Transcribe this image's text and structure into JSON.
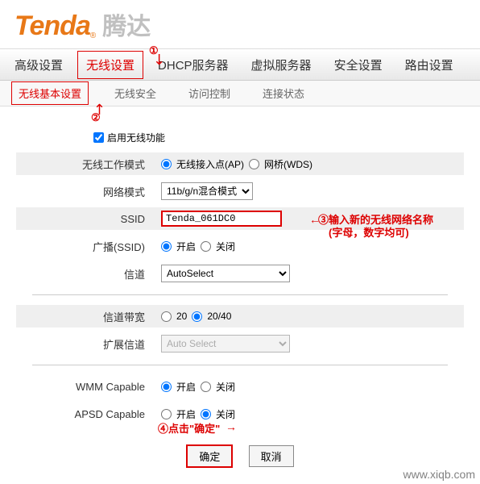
{
  "logo": {
    "en": "Tenda",
    "cn": "腾达"
  },
  "nav": {
    "items": [
      "高级设置",
      "无线设置",
      "DHCP服务器",
      "虚拟服务器",
      "安全设置",
      "路由设置"
    ],
    "activeIndex": 1
  },
  "subnav": {
    "items": [
      "无线基本设置",
      "无线安全",
      "访问控制",
      "连接状态"
    ],
    "activeIndex": 0
  },
  "form": {
    "enable_label": "启用无线功能",
    "mode_label": "无线工作模式",
    "mode_opt1": "无线接入点(AP)",
    "mode_opt2": "网桥(WDS)",
    "netmode_label": "网络模式",
    "netmode_value": "11b/g/n混合模式",
    "ssid_label": "SSID",
    "ssid_value": "Tenda_061DC0",
    "broadcast_label": "广播(SSID)",
    "on": "开启",
    "off": "关闭",
    "channel_label": "信道",
    "channel_value": "AutoSelect",
    "bandwidth_label": "信道带宽",
    "bw_opt1": "20",
    "bw_opt2": "20/40",
    "extchan_label": "扩展信道",
    "extchan_value": "Auto Select",
    "wmm_label": "WMM Capable",
    "apsd_label": "APSD Capable"
  },
  "buttons": {
    "ok": "确定",
    "cancel": "取消"
  },
  "annotations": {
    "a1": "①",
    "a2": "②",
    "a3": "③输入新的无线网络名称",
    "a3b": "(字母，数字均可)",
    "a4": "④点击\"确定\""
  },
  "watermark": "www.xiqb.com"
}
